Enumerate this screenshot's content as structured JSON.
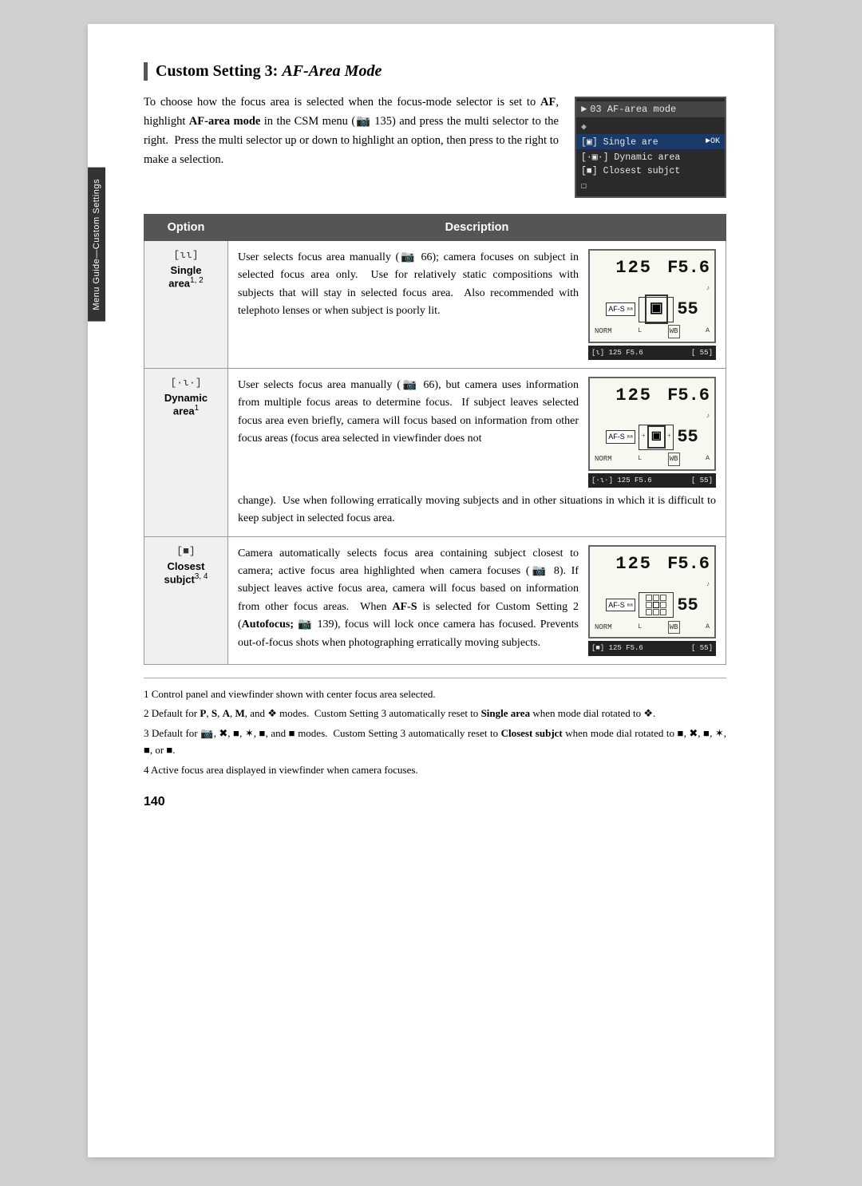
{
  "page": {
    "background": "#d0d0d0",
    "page_number": "140"
  },
  "side_tab": {
    "label": "Menu Guide—Custom Settings"
  },
  "header": {
    "title_prefix": "Custom Setting 3: ",
    "title_italic": "AF-Area Mode"
  },
  "intro": {
    "text": "To choose how the focus area is selected when the focus-mode selector is set to AF, highlight AF-area mode in the CSM menu (§ 135) and press the multi selector to the right.  Press the multi selector up or down to highlight an option, then press to the right to make a selection."
  },
  "camera_menu": {
    "header": "03 AF-area mode",
    "items": [
      {
        "label": "[o] Single are",
        "suffix": "►OK",
        "selected": true
      },
      {
        "label": "[·o·] Dynamic area",
        "selected": false
      },
      {
        "label": "[■] Closest subjct",
        "selected": false
      }
    ]
  },
  "table": {
    "col_option": "Option",
    "col_desc": "Description",
    "rows": [
      {
        "id": "single",
        "option_icon": "[ιι]",
        "option_label": "Single",
        "option_suffix": "area",
        "option_superscript": "1, 2",
        "description_text": "User selects focus area manually (§ 66); camera focuses on subject in selected focus area only.  Use for relatively static compositions with subjects that will stay in selected focus area.  Also recommended with telephoto lenses or when subject is poorly lit.",
        "viewfinder_shutter": "125",
        "viewfinder_aperture": "F5.6",
        "viewfinder_focus_type": "single",
        "viewfinder_number": "55",
        "status_left": "[ιι] 125 F5.6",
        "status_right": "[ 55]"
      },
      {
        "id": "dynamic",
        "option_icon": "[·ι·]",
        "option_label": "Dynamic",
        "option_suffix": "area",
        "option_superscript": "1",
        "description_text_part1": "User selects focus area manually (§ 66), but camera uses information from multiple focus areas to determine focus.  If subject leaves selected focus area even briefly, camera will focus based on information from other focus areas (focus area selected in viewfinder does not",
        "description_text_part2": "change).  Use when following erratically moving subjects and in other situations in which it is difficult to keep subject in selected focus area.",
        "viewfinder_shutter": "125",
        "viewfinder_aperture": "F5.6",
        "viewfinder_focus_type": "dynamic",
        "viewfinder_number": "55",
        "status_left": "[·ι·] 125 F5.6",
        "status_right": "[ 55]"
      },
      {
        "id": "closest",
        "option_icon": "[■]",
        "option_label": "Closest",
        "option_suffix": "subjct",
        "option_superscript": "3, 4",
        "description_text_part1": "Camera automatically selects focus area containing subject closest to camera; active focus area highlighted when camera focuses (§ 8). If subject leaves active focus area, camera will focus based on information from other focus areas.  When AF-S is selected for Custom Setting 2 (Autofocus; § 139), focus will lock once camera has focused. Prevents out-of-focus shots when photographing erratically moving subjects.",
        "viewfinder_shutter": "125",
        "viewfinder_aperture": "F5.6",
        "viewfinder_focus_type": "closest",
        "viewfinder_number": "55",
        "status_left": "[■] 125 F5.6",
        "status_right": "[ 55]"
      }
    ]
  },
  "footnotes": [
    "1 Control panel and viewfinder shown with center focus area selected.",
    "2 Default for P, S, A, M, and ❖ modes.  Custom Setting 3 automatically reset to Single area when mode dial rotated to ❖.",
    "3 Default for ■, ✖, ■, ✶, ■, and ■ modes.  Custom Setting 3 automatically reset to Closest subjct when mode dial rotated to ■, ✖, ■, ✶, ■, or ■.",
    "4 Active focus area displayed in viewfinder when camera focuses."
  ]
}
